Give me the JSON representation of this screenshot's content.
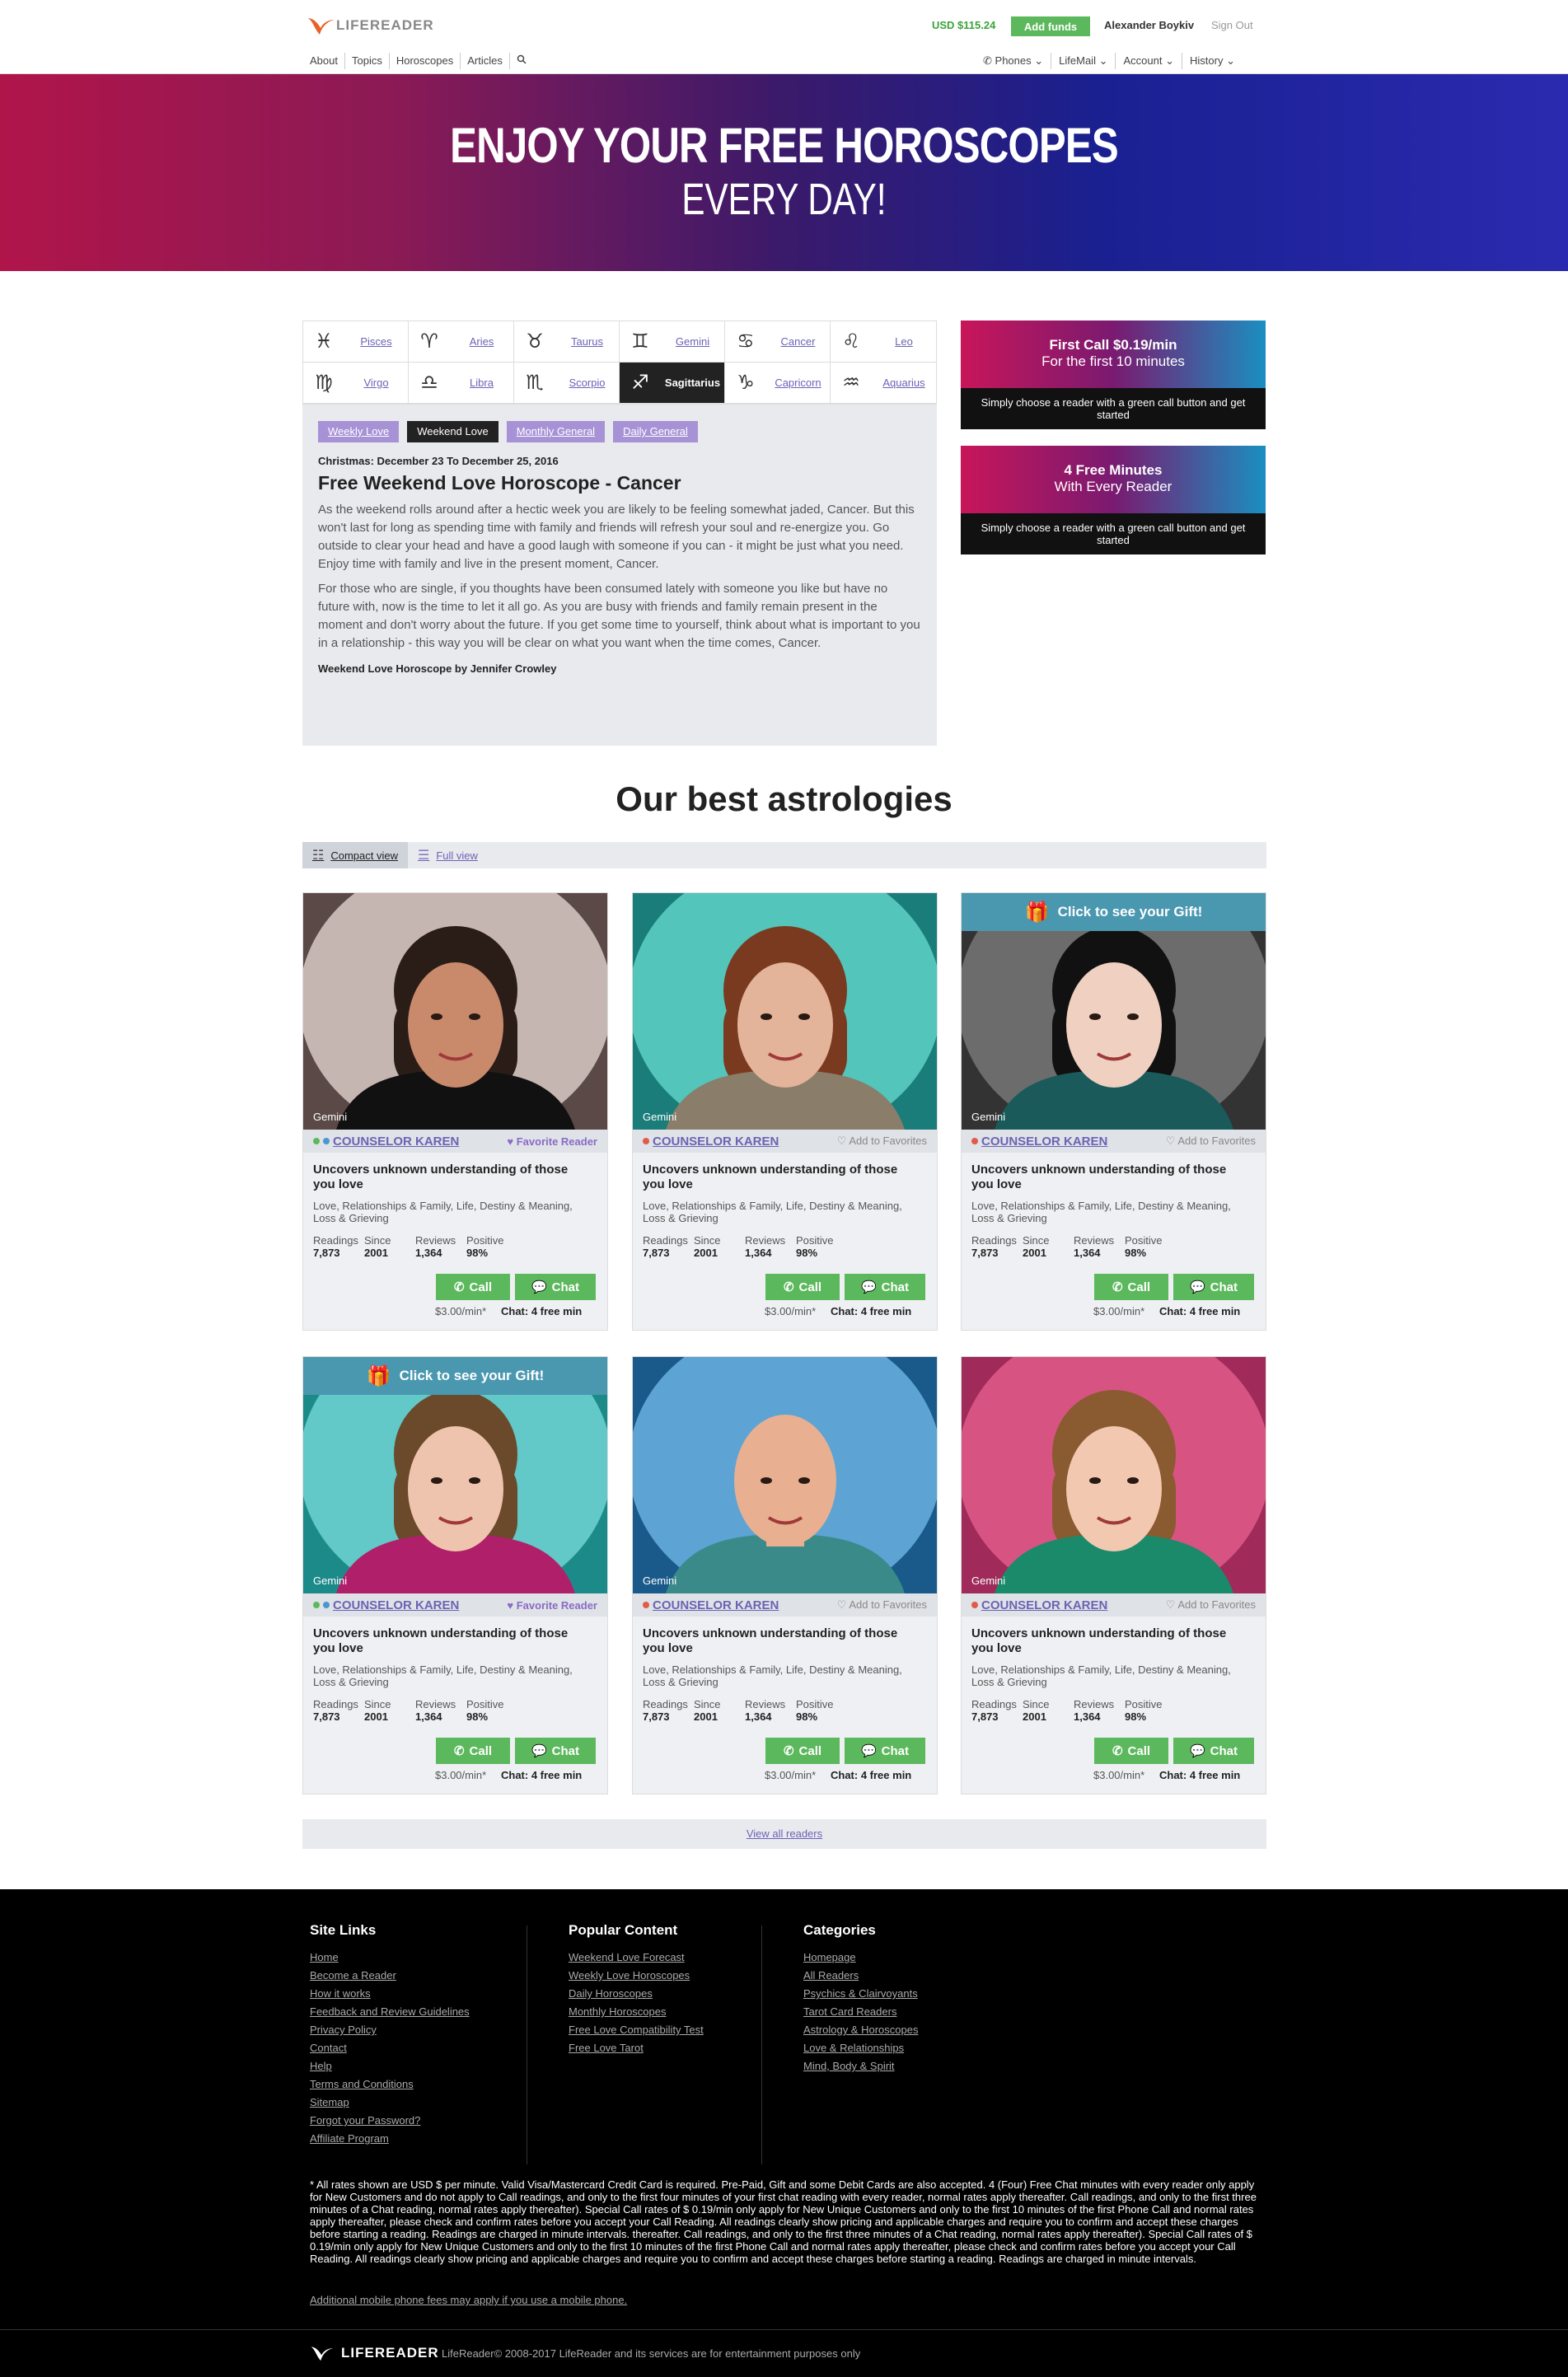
{
  "header": {
    "logo_text": "LIFEREADER",
    "balance": "USD $115.24",
    "add_funds": "Add funds",
    "user_name": "Alexander Boykiv",
    "sign_out": "Sign Out",
    "nav_left": [
      "About",
      "Topics",
      "Horoscopes",
      "Articles"
    ],
    "nav_right": [
      "Phones",
      "LifeMail",
      "Account",
      "History"
    ]
  },
  "hero": {
    "title": "ENJOY YOUR FREE HOROSCOPES",
    "subtitle": "EVERY DAY!"
  },
  "zodiac": [
    {
      "name": "Pisces",
      "symbol": "♓"
    },
    {
      "name": "Aries",
      "symbol": "♈"
    },
    {
      "name": "Taurus",
      "symbol": "♉"
    },
    {
      "name": "Gemini",
      "symbol": "♊"
    },
    {
      "name": "Cancer",
      "symbol": "♋"
    },
    {
      "name": "Leo",
      "symbol": "♌"
    },
    {
      "name": "Virgo",
      "symbol": "♍"
    },
    {
      "name": "Libra",
      "symbol": "♎"
    },
    {
      "name": "Scorpio",
      "symbol": "♏"
    },
    {
      "name": "Sagittarius",
      "symbol": "♐",
      "active": true
    },
    {
      "name": "Capricorn",
      "symbol": "♑"
    },
    {
      "name": "Aquarius",
      "symbol": "♒"
    }
  ],
  "horoscope": {
    "tabs": [
      "Weekly Love",
      "Weekend Love",
      "Monthly General",
      "Daily General"
    ],
    "active_tab": 1,
    "date": "Christmas: December 23 To December 25, 2016",
    "title": "Free Weekend Love Horoscope - Cancer",
    "paragraph1": "As the weekend rolls around after a hectic week you are likely to be feeling somewhat jaded, Cancer. But this won't last for long as spending time with family and friends will refresh your soul and re-energize you. Go outside to clear your head and have a good laugh with someone if you can - it might be just what you need. Enjoy time with family and live in the present moment, Cancer.",
    "paragraph2": "For those who are single, if you thoughts have been consumed lately with someone you like but have no future with, now is the time to let it all go. As you are busy with friends and family remain present in the moment and don't worry about the future. If you get some time to yourself, think about what is important to you in a relationship - this way you will be clear on what you want when the time comes, Cancer.",
    "byline": "Weekend Love Horoscope by Jennifer Crowley"
  },
  "promos": [
    {
      "line1": "First Call $0.19/min",
      "line2": "For the first 10 minutes",
      "text": "Simply choose a reader with a green call button and get started"
    },
    {
      "line1": "4 Free Minutes",
      "line2": "With Every Reader",
      "text": "Simply choose a reader with a green call button and get started"
    }
  ],
  "best": {
    "title": "Our best astrologies",
    "compact": "Compact view",
    "full": "Full view",
    "view_all": "View all readers"
  },
  "readers": [
    {
      "sign": "Gemini",
      "name": "COUNSELOR KAREN",
      "fav": "Favorite Reader",
      "fav_on": true,
      "dots": [
        "#5cb85c",
        "#4a97d0"
      ],
      "gift": false,
      "bg": [
        "#d9c9c6",
        "#5a4946"
      ],
      "skin": "#c98a6c",
      "hair": "#2a1d18",
      "shirt": "#111111",
      "bald": false
    },
    {
      "sign": "Gemini",
      "name": "COUNSELOR KAREN",
      "fav": "Add to Favorites",
      "fav_on": false,
      "dots": [
        "#e25a4a"
      ],
      "gift": false,
      "bg": [
        "#5ed1c7",
        "#1a7d7a"
      ],
      "skin": "#e3b39a",
      "hair": "#7a3a20",
      "shirt": "#8a7d6a",
      "bald": false
    },
    {
      "sign": "Gemini",
      "name": "COUNSELOR KAREN",
      "fav": "Add to Favorites",
      "fav_on": false,
      "dots": [
        "#e25a4a"
      ],
      "gift": true,
      "gift_text": "Click to see your Gift!",
      "bg": [
        "#777777",
        "#333333"
      ],
      "skin": "#f0d0c0",
      "hair": "#111111",
      "shirt": "#1a5a5a",
      "bald": false
    },
    {
      "sign": "Gemini",
      "name": "COUNSELOR KAREN",
      "fav": "Favorite Reader",
      "fav_on": true,
      "dots": [
        "#5cb85c",
        "#4a97d0"
      ],
      "gift": true,
      "gift_text": "Click to see your Gift!",
      "bg": [
        "#6fd2d2",
        "#1d8a8a"
      ],
      "skin": "#efc4ae",
      "hair": "#6a4a2a",
      "shirt": "#b0206a",
      "bald": false
    },
    {
      "sign": "Gemini",
      "name": "COUNSELOR KAREN",
      "fav": "Add to Favorites",
      "fav_on": false,
      "dots": [
        "#e25a4a"
      ],
      "gift": false,
      "bg": [
        "#6ab0e0",
        "#1a5a8a"
      ],
      "skin": "#e8b090",
      "hair": "#b08060",
      "shirt": "#3a8a8a",
      "bald": true
    },
    {
      "sign": "Gemini",
      "name": "COUNSELOR KAREN",
      "fav": "Add to Favorites",
      "fav_on": false,
      "dots": [
        "#e25a4a"
      ],
      "gift": false,
      "bg": [
        "#e05a8a",
        "#a02a5a"
      ],
      "skin": "#f2c8b0",
      "hair": "#8a5a30",
      "shirt": "#1a8a6a",
      "bald": false
    }
  ],
  "reader_common": {
    "title": "Uncovers unknown understanding of those you love",
    "categories": "Love, Relationships & Family, Life, Destiny & Meaning, Loss & Grieving",
    "stats": [
      {
        "label": "Readings",
        "value": "7,873"
      },
      {
        "label": "Since",
        "value": "2001"
      },
      {
        "label": "Reviews",
        "value": "1,364"
      },
      {
        "label": "Positive",
        "value": "98%"
      }
    ],
    "call": "Call",
    "chat": "Chat",
    "rate": "$3.00/min*",
    "chat_free": "Chat: 4 free min"
  },
  "footer": {
    "site_links_title": "Site Links",
    "site_links": [
      "Home",
      "Become a Reader",
      "How it works",
      "Feedback and Review Guidelines",
      "Privacy Policy",
      "Contact",
      "Help",
      "Terms and Conditions",
      "Sitemap",
      "Forgot your Password?",
      "Affiliate Program"
    ],
    "popular_title": "Popular Content",
    "popular": [
      "Weekend Love Forecast",
      "Weekly Love Horoscopes",
      "Daily Horoscopes",
      "Monthly Horoscopes",
      "Free Love Compatibility Test",
      "Free Love Tarot"
    ],
    "categories_title": "Categories",
    "categories": [
      "Homepage",
      "All Readers",
      "Psychics & Clairvoyants",
      "Tarot Card Readers",
      "Astrology & Horoscopes",
      "Love & Relationships",
      "Mind, Body & Spirit"
    ],
    "disclaimer": "* All rates shown are USD $ per minute. Valid Visa/Mastercard Credit Card is required. Pre-Paid, Gift and some Debit Cards are also accepted. 4 (Four) Free Chat minutes with every reader only apply for New Customers and do not apply to Call readings, and only to the first four minutes of your first chat reading with every reader, normal rates apply thereafter. Call readings, and only to the first three minutes of a Chat reading, normal rates apply thereafter). Special Call rates of $ 0.19/min only apply for New Unique Customers and only to the first 10 minutes of the first Phone Call and normal rates apply thereafter, please check and confirm rates before you accept your Call Reading. All readings clearly show pricing and applicable charges and require you to confirm and accept these charges before starting a reading. Readings are charged in minute intervals. thereafter. Call readings, and only to the first three minutes of a Chat reading, normal rates apply thereafter). Special Call rates of $ 0.19/min only apply for New Unique Customers and only to the first 10 minutes of the first Phone Call and normal rates apply thereafter, please check and confirm rates before you accept your Call Reading. All readings clearly show pricing and applicable charges and require you to confirm and accept these charges before starting a reading. Readings are charged in minute intervals.",
    "mobile_note": "Additional mobile phone fees may apply if you use a mobile phone.",
    "logo_text": "LIFEREADER",
    "copyright": "LifeReader© 2008-2017 LifeReader and its services are for entertainment purposes only"
  }
}
